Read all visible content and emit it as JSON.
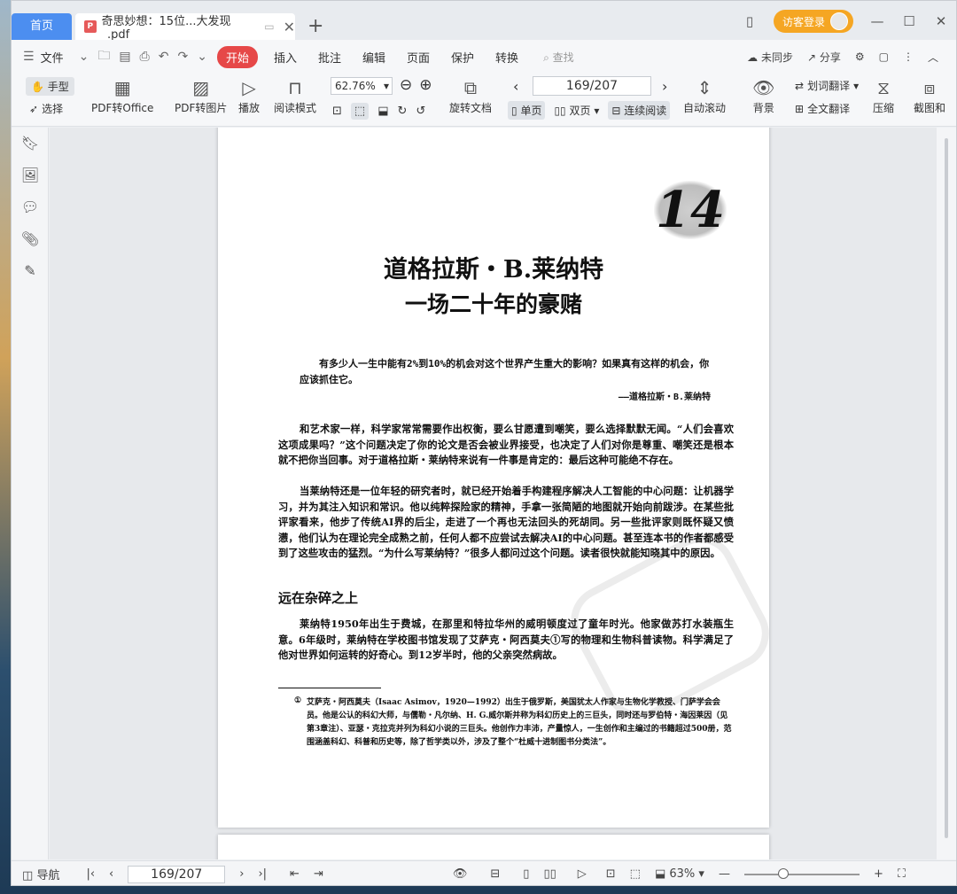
{
  "titlebar": {
    "home_tab": "首页",
    "doc_tab": "奇思妙想：15位...大发现_.pdf",
    "guest_login": "访客登录"
  },
  "menu": {
    "file": "文件",
    "start": "开始",
    "items": [
      "插入",
      "批注",
      "编辑",
      "页面",
      "保护",
      "转换"
    ],
    "search": "查找",
    "unsynced": "未同步",
    "share": "分享"
  },
  "ribbon": {
    "hand": "手型",
    "select": "选择",
    "pdf_to_office": "PDF转Office",
    "pdf_to_image": "PDF转图片",
    "play": "播放",
    "read_mode": "阅读模式",
    "zoom": "62.76%",
    "rotate_doc": "旋转文档",
    "page_field": "169/207",
    "single": "单页",
    "double": "双页",
    "continuous": "连续阅读",
    "auto_scroll": "自动滚动",
    "background": "背景",
    "word_translate": "划词翻译",
    "full_translate": "全文翻译",
    "compress": "压缩",
    "screenshot": "截图和"
  },
  "page": {
    "chapter_number": "14",
    "title_1": "道格拉斯・B.莱纳特",
    "title_2": "一场二十年的豪赌",
    "epigraph": "有多少人一生中能有2%到10%的机会对这个世界产生重大的影响？如果真有这样的机会，你应该抓住它。",
    "epigraph_author": "——道格拉斯・B.莱纳特",
    "para_1": "和艺术家一样，科学家常常需要作出权衡，要么甘愿遭到嘲笑，要么选择默默无闻。“人们会喜欢这项成果吗？”这个问题决定了你的论文是否会被业界接受，也决定了人们对你是尊重、嘲笑还是根本就不把你当回事。对于道格拉斯・莱纳特来说有一件事是肯定的：最后这种可能绝不存在。",
    "para_2": "当莱纳特还是一位年轻的研究者时，就已经开始着手构建程序解决人工智能的中心问题：让机器学习，并为其注入知识和常识。他以纯粹探险家的精神，手拿一张简陋的地图就开始向前跋涉。在某些批评家看来，他步了传统AI界的后尘，走进了一个再也无法回头的死胡同。另一些批评家则既怀疑又愤懑，他们认为在理论完全成熟之前，任何人都不应尝试去解决AI的中心问题。甚至连本书的作者都感受到了这些攻击的猛烈。“为什么写莱纳特？”很多人都问过这个问题。读者很快就能知晓其中的原因。",
    "section_heading": "远在杂碎之上",
    "para_3": "莱纳特1950年出生于费城，在那里和特拉华州的威明顿度过了童年时光。他家做苏打水装瓶生意。6年级时，莱纳特在学校图书馆发现了艾萨克・阿西莫夫①写的物理和生物科普读物。科学满足了他对世界如何运转的好奇心。到12岁半时，他的父亲突然病故。",
    "footnote_mark": "①",
    "footnote": "艾萨克・阿西莫夫（Isaac Asimov，1920—1992）出生于俄罗斯，美国犹太人作家与生物化学教授、门萨学会会员。他是公认的科幻大师，与儒勒・凡尔纳、H. G.威尔斯并称为科幻历史上的三巨头，同时还与罗伯特・海因莱因（见第3章注）、亚瑟・克拉克并列为科幻小说的三巨头。他创作力丰沛，产量惊人，一生创作和主编过的书籍超过500册，范围涵盖科幻、科普和历史等，除了哲学类以外，涉及了整个“杜威十进制图书分类法”。"
  },
  "statusbar": {
    "nav": "导航",
    "page_field": "169/207",
    "zoom": "63%"
  }
}
